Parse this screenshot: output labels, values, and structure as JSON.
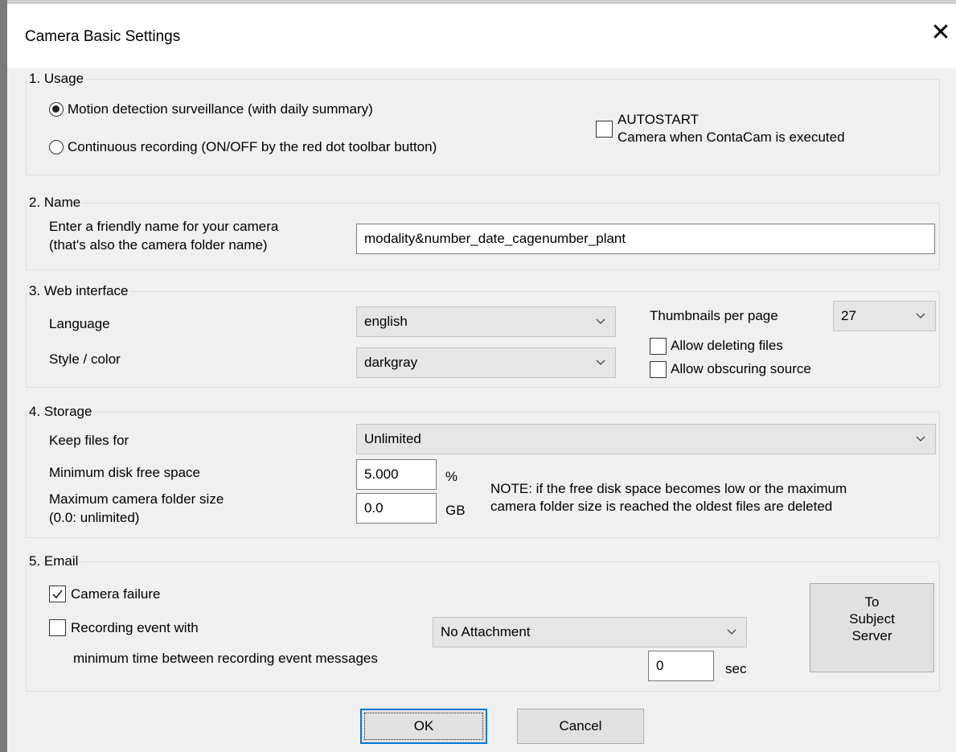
{
  "window": {
    "title": "Camera Basic Settings",
    "close_glyph": "✕"
  },
  "usage": {
    "legend": "1. Usage",
    "options": [
      {
        "label": "Motion detection surveillance (with daily summary)",
        "selected": true
      },
      {
        "label": "Continuous recording (ON/OFF by the red dot toolbar button)",
        "selected": false
      }
    ],
    "autostart": {
      "line1": "AUTOSTART",
      "line2": "Camera when ContaCam is executed",
      "checked": false
    }
  },
  "name": {
    "legend": "2. Name",
    "label_line1": "Enter a friendly name for your camera",
    "label_line2": "(that's also the camera folder name)",
    "value": "modality&number_date_cagenumber_plant"
  },
  "web": {
    "legend": "3. Web interface",
    "language_label": "Language",
    "language_value": "english",
    "style_label": "Style / color",
    "style_value": "darkgray",
    "thumbs_label": "Thumbnails per page",
    "thumbs_value": "27",
    "allow_delete": {
      "label": "Allow deleting files",
      "checked": false
    },
    "allow_obscure": {
      "label": "Allow obscuring source",
      "checked": false
    }
  },
  "storage": {
    "legend": "4. Storage",
    "keep_label": "Keep files for",
    "keep_value": "Unlimited",
    "min_free_label": "Minimum disk free space",
    "min_free_value": "5.000",
    "min_free_unit": "%",
    "max_size_label_line1": "Maximum camera folder size",
    "max_size_label_line2": "(0.0: unlimited)",
    "max_size_value": "0.0",
    "max_size_unit": "GB",
    "note_line1": "NOTE: if the free disk space becomes low or the maximum",
    "note_line2": "camera folder size is reached the oldest files are deleted"
  },
  "email": {
    "legend": "5. Email",
    "camera_failure": {
      "label": "Camera failure",
      "checked": true
    },
    "recording_event": {
      "label": "Recording event with",
      "checked": false
    },
    "attachment_value": "No Attachment",
    "min_time_label": "minimum time between recording event messages",
    "min_time_value": "0",
    "min_time_unit": "sec",
    "server_button": {
      "line1": "To",
      "line2": "Subject",
      "line3": "Server"
    }
  },
  "buttons": {
    "ok": "OK",
    "cancel": "Cancel"
  },
  "icons": {
    "chevron": "chevron-down-icon",
    "check": "checkmark-icon",
    "close": "close-icon"
  }
}
